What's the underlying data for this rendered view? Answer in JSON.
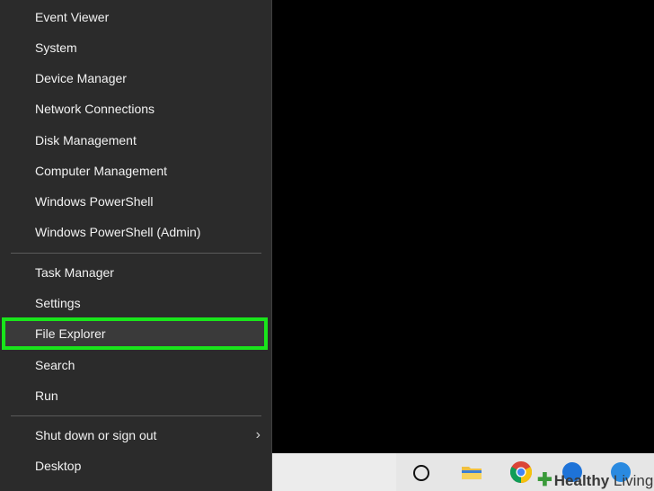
{
  "menu": {
    "items": [
      {
        "label": "Event Viewer"
      },
      {
        "label": "System"
      },
      {
        "label": "Device Manager"
      },
      {
        "label": "Network Connections"
      },
      {
        "label": "Disk Management"
      },
      {
        "label": "Computer Management"
      },
      {
        "label": "Windows PowerShell"
      },
      {
        "label": "Windows PowerShell (Admin)"
      },
      {
        "label": "Task Manager"
      },
      {
        "label": "Settings"
      },
      {
        "label": "File Explorer"
      },
      {
        "label": "Search"
      },
      {
        "label": "Run"
      },
      {
        "label": "Shut down or sign out"
      },
      {
        "label": "Desktop"
      }
    ],
    "submenu_chevron": "›",
    "highlight_color": "#19e51b"
  },
  "taskbar": {
    "icons": [
      "cortana-icon",
      "file-explorer-icon",
      "chrome-icon",
      "edge-icon",
      "edge-icon"
    ]
  },
  "watermark": {
    "bold": "Healthy",
    "light": "Living"
  }
}
